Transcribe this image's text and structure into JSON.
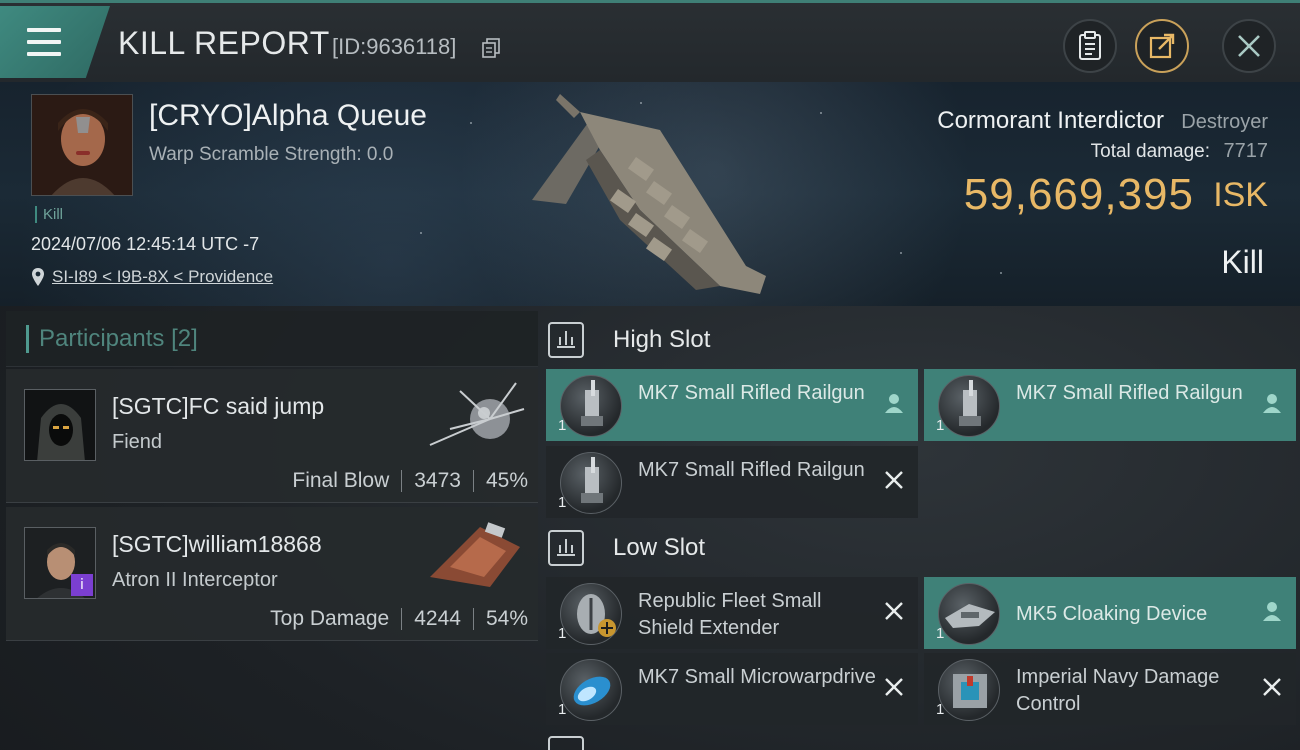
{
  "header": {
    "title": "KILL REPORT",
    "report_id": "[ID:9636118]"
  },
  "victim": {
    "name": "[CRYO]Alpha Queue",
    "warp_scramble": "Warp Scramble Strength: 0.0",
    "tag": "Kill",
    "datetime": "2024/07/06 12:45:14 UTC -7",
    "location": "SI-I89 < I9B-8X < Providence",
    "ship_name": "Cormorant Interdictor",
    "ship_class": "Destroyer",
    "total_damage_label": "Total damage:",
    "total_damage": "7717",
    "isk_value": "59,669,395",
    "isk_unit": "ISK",
    "result": "Kill"
  },
  "participants": {
    "label": "Participants",
    "count": "[2]",
    "items": [
      {
        "name": "[SGTC]FC said jump",
        "ship": "Fiend",
        "role": "Final Blow",
        "damage": "3473",
        "percent": "45%"
      },
      {
        "name": "[SGTC]william18868",
        "ship": "Atron II Interceptor",
        "role": "Top Damage",
        "damage": "4244",
        "percent": "54%"
      }
    ]
  },
  "slots": {
    "high": {
      "title": "High Slot",
      "modules": [
        {
          "name": "MK7 Small Rifled Railgun",
          "qty": "1",
          "status": "person-icon",
          "highlight": true
        },
        {
          "name": "MK7 Small Rifled Railgun",
          "qty": "1",
          "status": "person-icon",
          "highlight": true
        },
        {
          "name": "MK7 Small Rifled Railgun",
          "qty": "1",
          "status": "close-icon",
          "highlight": false
        }
      ]
    },
    "low": {
      "title": "Low Slot",
      "modules": [
        {
          "name": "Republic Fleet Small Shield Extender",
          "qty": "1",
          "status": "close-icon",
          "highlight": false
        },
        {
          "name": "MK5 Cloaking Device",
          "qty": "1",
          "status": "person-icon",
          "highlight": true
        },
        {
          "name": "MK7 Small Microwarpdrive",
          "qty": "1",
          "status": "close-icon",
          "highlight": false
        },
        {
          "name": "Imperial Navy Damage Control",
          "qty": "1",
          "status": "close-icon",
          "highlight": false
        }
      ]
    }
  },
  "colors": {
    "accent": "#3f8178",
    "isk": "#e8b866",
    "badge": "#7b3fd1"
  }
}
